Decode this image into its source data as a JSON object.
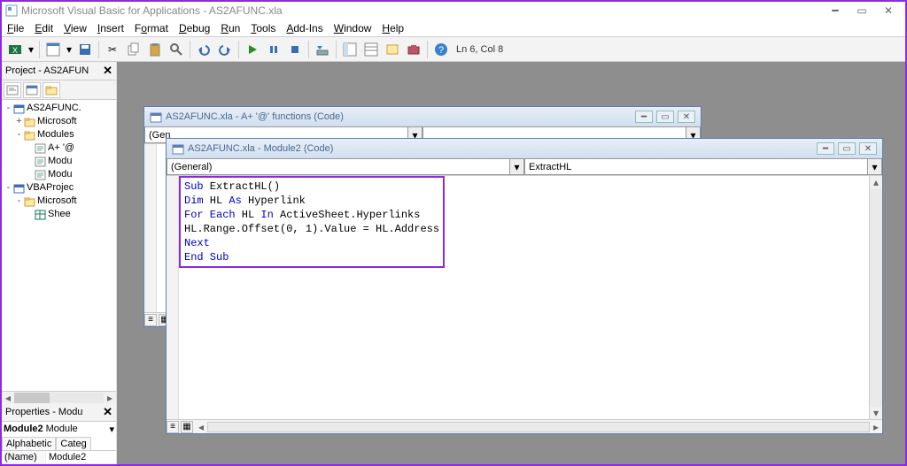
{
  "app_title": "Microsoft Visual Basic for Applications - AS2AFUNC.xla",
  "menu": [
    "File",
    "Edit",
    "View",
    "Insert",
    "Format",
    "Debug",
    "Run",
    "Tools",
    "Add-Ins",
    "Window",
    "Help"
  ],
  "toolbar_status": "Ln 6, Col 8",
  "project_panel": {
    "title": "Project - AS2AFUN",
    "tree": [
      {
        "indent": 0,
        "exp": "-",
        "icon": "vba",
        "label": "AS2AFUNC."
      },
      {
        "indent": 1,
        "exp": "+",
        "icon": "folder",
        "label": "Microsoft"
      },
      {
        "indent": 1,
        "exp": "-",
        "icon": "folder",
        "label": "Modules"
      },
      {
        "indent": 2,
        "exp": "",
        "icon": "module",
        "label": "A+ '@"
      },
      {
        "indent": 2,
        "exp": "",
        "icon": "module",
        "label": "Modu"
      },
      {
        "indent": 2,
        "exp": "",
        "icon": "module",
        "label": "Modu"
      },
      {
        "indent": 0,
        "exp": "-",
        "icon": "vba",
        "label": "VBAProjec"
      },
      {
        "indent": 1,
        "exp": "-",
        "icon": "folder",
        "label": "Microsoft"
      },
      {
        "indent": 2,
        "exp": "",
        "icon": "sheet",
        "label": "Shee"
      }
    ]
  },
  "properties_panel": {
    "title": "Properties - Modu",
    "object": "Module2",
    "object_type": "Module",
    "tabs": [
      "Alphabetic",
      "Categ"
    ],
    "rows": [
      {
        "k": "(Name)",
        "v": "Module2"
      }
    ]
  },
  "code_windows": {
    "back": {
      "title": "AS2AFUNC.xla - A+ '@' functions (Code)",
      "left_dd": "(Gen",
      "right_dd": ""
    },
    "front": {
      "title": "AS2AFUNC.xla - Module2 (Code)",
      "left_dd": "(General)",
      "right_dd": "ExtractHL",
      "code_tokens": [
        [
          {
            "t": "Sub",
            "kw": true
          },
          {
            "t": " ExtractHL()",
            "kw": false
          }
        ],
        [
          {
            "t": "Dim",
            "kw": true
          },
          {
            "t": " HL ",
            "kw": false
          },
          {
            "t": "As",
            "kw": true
          },
          {
            "t": " Hyperlink",
            "kw": false
          }
        ],
        [
          {
            "t": "For Each",
            "kw": true
          },
          {
            "t": " HL ",
            "kw": false
          },
          {
            "t": "In",
            "kw": true
          },
          {
            "t": " ActiveSheet.Hyperlinks",
            "kw": false
          }
        ],
        [
          {
            "t": "HL.Range.Offset(0, 1).Value = HL.Address",
            "kw": false
          }
        ],
        [
          {
            "t": "Next",
            "kw": true
          }
        ],
        [
          {
            "t": "End Sub",
            "kw": true
          }
        ]
      ]
    }
  }
}
